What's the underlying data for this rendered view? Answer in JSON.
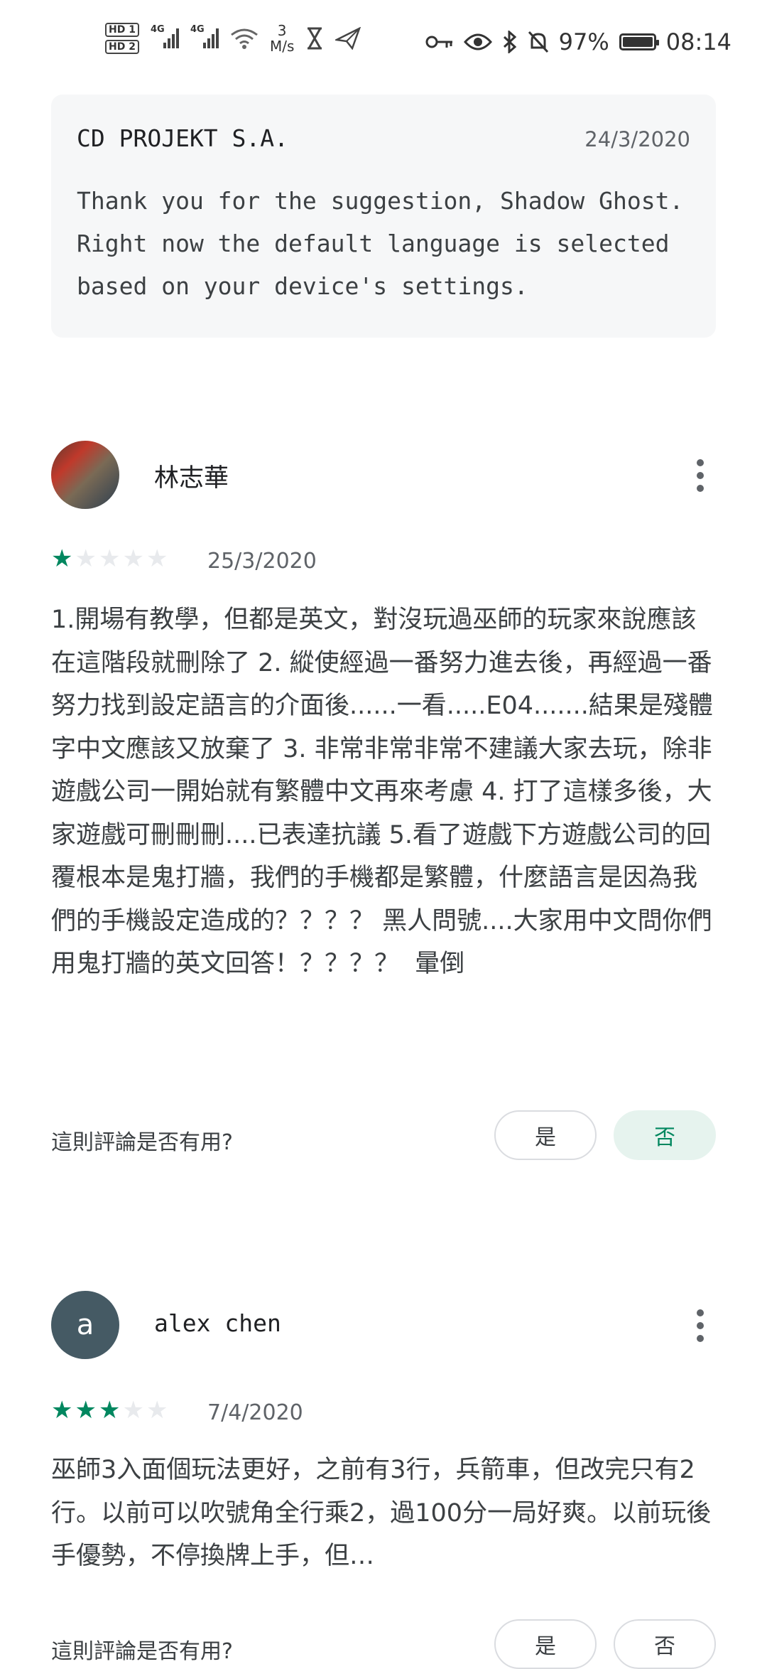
{
  "status_bar": {
    "hd1": "HD 1",
    "hd2": "HD 2",
    "sig1_tag": "4G",
    "sig2_tag": "4G",
    "speed_value": "3",
    "speed_unit": "M/s",
    "battery": "97%",
    "time": "08:14"
  },
  "developer_reply": {
    "developer": "CD PROJEKT S.A.",
    "date": "24/3/2020",
    "text": "Thank you for the suggestion, Shadow Ghost. Right now the default language is selected based on your device's settings."
  },
  "reviews": [
    {
      "author": "林志華",
      "avatar_letter": "",
      "rating": 1,
      "date": "25/3/2020",
      "text": "1.開場有教學，但都是英文，對沒玩過巫師的玩家來說應該在這階段就刪除了 2. 縱使經過一番努力進去後，再經過一番努力找到設定語言的介面後......一看.....E04.......結果是殘體字中文應該又放棄了 3. 非常非常非常不建議大家去玩，除非遊戲公司一開始就有繁體中文再來考慮 4. 打了這樣多後，大家遊戲可刪刪刪....已表達抗議 5.看了遊戲下方遊戲公司的回覆根本是鬼打牆，我們的手機都是繁體，什麼語言是因為我們的手機設定造成的？？？？ 黑人問號....大家用中文問你們用鬼打牆的英文回答！？？？？  暈倒",
      "helpful_question": "這則評論是否有用?",
      "yes_label": "是",
      "no_label": "否",
      "selected": "no"
    },
    {
      "author": "alex chen",
      "avatar_letter": "a",
      "rating": 3,
      "date": "7/4/2020",
      "text": "巫師3入面個玩法更好，之前有3行，兵箭車，但改完只有2行。以前可以吹號角全行乘2，過100分一局好爽。以前玩後手優勢，不停換牌上手，但…",
      "helpful_question": "這則評論是否有用?",
      "yes_label": "是",
      "no_label": "否",
      "selected": ""
    }
  ],
  "colors": {
    "star_on": "#01875f",
    "star_off": "#e8eaed",
    "selected_bg": "#e6f3ee",
    "reply_bg": "#f6f7f8"
  }
}
